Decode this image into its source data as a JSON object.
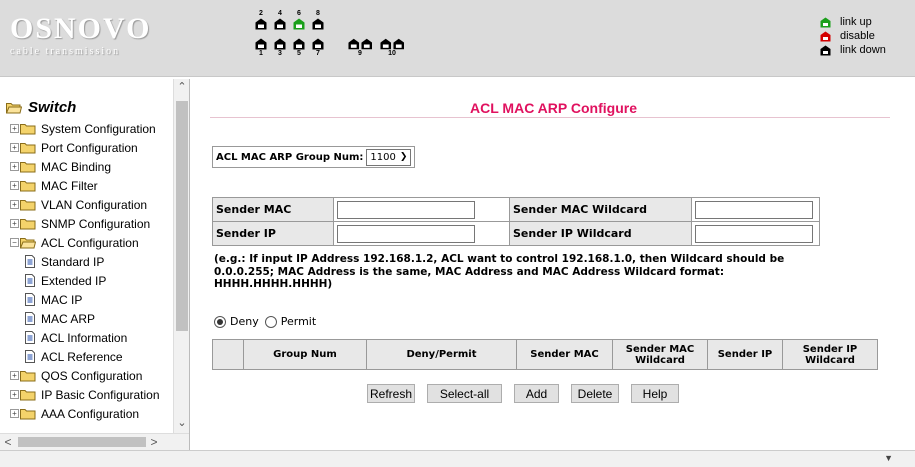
{
  "header": {
    "brand": "OSNOVO",
    "tagline": "cable transmission",
    "ports_top": [
      "2",
      "4",
      "6",
      "8"
    ],
    "ports_bottom": [
      "1",
      "3",
      "5",
      "7"
    ],
    "ports_extra": [
      "9",
      "10"
    ],
    "legend": [
      {
        "label": "link up",
        "color": "#1a9f1a"
      },
      {
        "label": "disable",
        "color": "#d40000"
      },
      {
        "label": "link down",
        "color": "#000000"
      }
    ]
  },
  "sidebar": {
    "root_label": "Switch",
    "items": [
      {
        "label": "System Configuration",
        "type": "folder",
        "expander": "+"
      },
      {
        "label": "Port Configuration",
        "type": "folder",
        "expander": "+"
      },
      {
        "label": "MAC Binding",
        "type": "folder",
        "expander": "+"
      },
      {
        "label": "MAC Filter",
        "type": "folder",
        "expander": "+"
      },
      {
        "label": "VLAN Configuration",
        "type": "folder",
        "expander": "+"
      },
      {
        "label": "SNMP Configuration",
        "type": "folder",
        "expander": "+"
      },
      {
        "label": "ACL Configuration",
        "type": "open-folder",
        "expander": "−"
      },
      {
        "label": "Standard IP",
        "type": "doc"
      },
      {
        "label": "Extended IP",
        "type": "doc"
      },
      {
        "label": "MAC IP",
        "type": "doc"
      },
      {
        "label": "MAC ARP",
        "type": "doc"
      },
      {
        "label": "ACL Information",
        "type": "doc"
      },
      {
        "label": "ACL Reference",
        "type": "doc"
      },
      {
        "label": "QOS Configuration",
        "type": "folder",
        "expander": "+"
      },
      {
        "label": "IP Basic Configuration",
        "type": "folder",
        "expander": "+"
      },
      {
        "label": "AAA Configuration",
        "type": "folder",
        "expander": "+"
      }
    ]
  },
  "main": {
    "title": "ACL MAC ARP Configure",
    "group_num_label": "ACL MAC ARP Group Num:",
    "group_num_value": "1100",
    "form": {
      "sender_mac_label": "Sender MAC",
      "sender_mac_value": "",
      "sender_mac_wildcard_label": "Sender MAC Wildcard",
      "sender_mac_wildcard_value": "",
      "sender_ip_label": "Sender IP",
      "sender_ip_value": "",
      "sender_ip_wildcard_label": "Sender IP Wildcard",
      "sender_ip_wildcard_value": ""
    },
    "hint": "(e.g.: If input IP Address 192.168.1.2, ACL want to control 192.168.1.0, then Wildcard should be 0.0.0.255; MAC Address is the same, MAC Address and MAC Address Wildcard format: HHHH.HHHH.HHHH)",
    "radio_deny": "Deny",
    "radio_permit": "Permit",
    "selected_action": "Deny",
    "table_headers": [
      "",
      "Group Num",
      "Deny/Permit",
      "Sender MAC",
      "Sender MAC Wildcard",
      "Sender IP",
      "Sender IP Wildcard"
    ],
    "buttons": {
      "refresh": "Refresh",
      "select_all": "Select-all",
      "add": "Add",
      "delete": "Delete",
      "help": "Help"
    }
  }
}
